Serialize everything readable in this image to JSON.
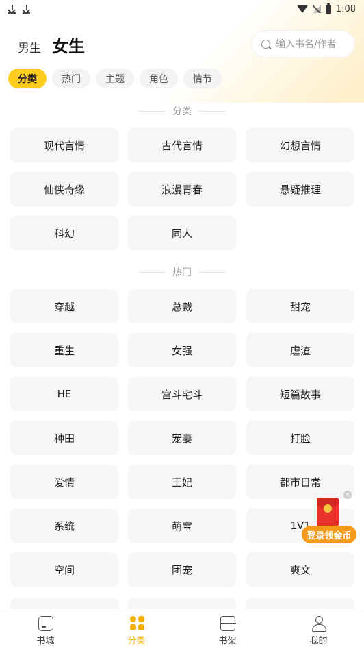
{
  "status_bar": {
    "time": "1:08"
  },
  "header": {
    "gender_tabs": [
      "男生",
      "女生"
    ],
    "search_placeholder": "输入书名/作者"
  },
  "filter_chips": [
    "分类",
    "热门",
    "主题",
    "角色",
    "情节"
  ],
  "sections": [
    {
      "title": "分类",
      "tags": [
        "现代言情",
        "古代言情",
        "幻想言情",
        "仙侠奇缘",
        "浪漫青春",
        "悬疑推理",
        "科幻",
        "同人"
      ]
    },
    {
      "title": "热门",
      "tags": [
        "穿越",
        "总裁",
        "甜宠",
        "重生",
        "女强",
        "虐渣",
        "HE",
        "宫斗宅斗",
        "短篇故事",
        "种田",
        "宠妻",
        "打脸",
        "爱情",
        "王妃",
        "都市日常",
        "系统",
        "萌宝",
        "1V1",
        "空间",
        "团宠",
        "爽文"
      ]
    }
  ],
  "promo": {
    "label": "登录领金币"
  },
  "bottom_nav": [
    "书城",
    "分类",
    "书架",
    "我的"
  ],
  "colors": {
    "accent": "#ffcd1e",
    "nav_active": "#f2b100",
    "promo": "#f49a1a"
  }
}
